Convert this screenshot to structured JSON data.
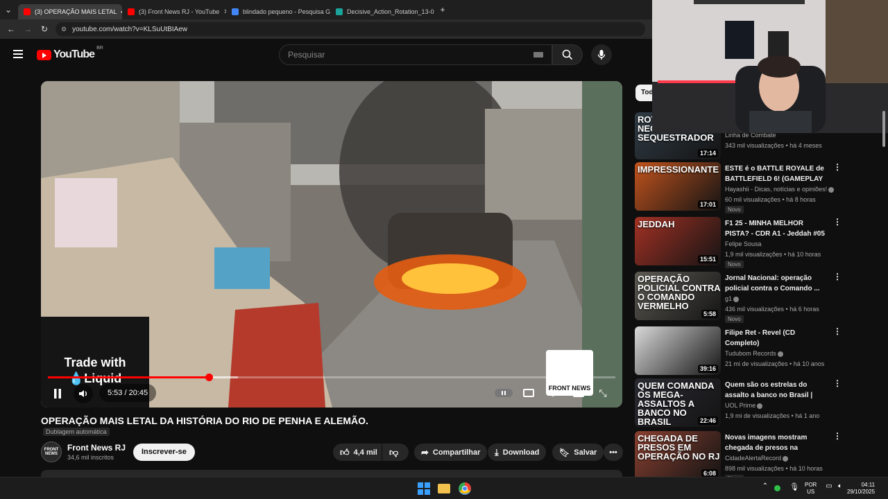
{
  "browser": {
    "tabs": [
      {
        "label": "(3) OPERAÇÃO MAIS LETAL",
        "active": true,
        "fav_color": "#ff0000"
      },
      {
        "label": "(3) Front News RJ - YouTube",
        "active": false,
        "fav_color": "#ff0000"
      },
      {
        "label": "blindado pequeno - Pesquisa G",
        "active": false,
        "fav_color": "#4285f4"
      },
      {
        "label": "Decisive_Action_Rotation_13-0",
        "active": false,
        "fav_color": "#1aa39a"
      }
    ],
    "url": "youtube.com/watch?v=KLSuUtBIAew"
  },
  "header": {
    "logo_text": "YouTube",
    "logo_region": "BR",
    "search_placeholder": "Pesquisar"
  },
  "player": {
    "ad_line1": "Trade with",
    "ad_line2": "Liquid",
    "watermark": "FRONT NEWS",
    "time": "5:53 / 20:45",
    "progress": 0.284,
    "buffered": 0.335
  },
  "video": {
    "title": "OPERAÇÃO MAIS LETAL DA HISTÓRIA DO RIO DE PENHA E ALEMÃO.",
    "dub_label": "Dublagem automática",
    "channel_name": "Front News RJ",
    "subscribers": "34,6 mil inscritos",
    "subscribe_label": "Inscrever-se",
    "likes": "4,4 mil",
    "share_label": "Compartilhar",
    "download_label": "Download",
    "save_label": "Salvar"
  },
  "sidebar": {
    "chip": "Todos",
    "items": [
      {
        "thumb_caption": "ROTA E GATE NEGOCIAM COM SEQUESTRADOR",
        "duration": "17:14",
        "title": "",
        "channel": "Linha de Combate",
        "meta": "343 mil visualizações • há 4 meses",
        "verified": false,
        "badge": "",
        "thumb_color": "#2f3b44"
      },
      {
        "thumb_caption": "IMPRESSIONANTE",
        "duration": "17:01",
        "title": "ESTE é o BATTLE ROYALE de BATTLEFIELD 6! (GAMEPLAY ...",
        "channel": "Hayashii - Dicas, notícias e opiniões!",
        "meta": "60 mil visualizações • há 8 horas",
        "verified": true,
        "badge": "Novo",
        "thumb_color": "#c1531d"
      },
      {
        "thumb_caption": "JEDDAH",
        "duration": "15:51",
        "title": "F1 25 - MINHA MELHOR PISTA? - CDR A1 - Jeddah #05",
        "channel": "Felipe Sousa",
        "meta": "1,9 mil visualizações • há 10 horas",
        "verified": false,
        "badge": "Novo",
        "thumb_color": "#a33124"
      },
      {
        "thumb_caption": "OPERAÇÃO POLICIAL CONTRA O COMANDO VERMELHO",
        "duration": "5:58",
        "title": "Jornal Nacional: operação policial contra o Comando ...",
        "channel": "g1",
        "meta": "436 mil visualizações • há 6 horas",
        "verified": true,
        "badge": "Novo",
        "thumb_color": "#5c5a52"
      },
      {
        "thumb_caption": "",
        "duration": "39:16",
        "title": "Filipe Ret - Revel (CD Completo)",
        "channel": "Tudubom Records",
        "meta": "21 mi de visualizações • há 10 anos",
        "verified": true,
        "badge": "",
        "thumb_color": "#d9d9d9"
      },
      {
        "thumb_caption": "QUEM COMANDA OS MEGA-ASSALTOS A BANCO NO BRASIL",
        "duration": "22:46",
        "title": "Quem são os estrelas do assalto a banco no Brasil | Doc...",
        "channel": "UOL Prime",
        "meta": "1,9 mi de visualizações • há 1 ano",
        "verified": true,
        "badge": "",
        "thumb_color": "#2a2a33"
      },
      {
        "thumb_caption": "CHEGADA DE PRESOS EM OPERAÇÃO NO RJ",
        "duration": "6:08",
        "title": "Novas imagens mostram chegada de presos na delegac...",
        "channel": "CidadeAlertaRecord",
        "meta": "898 mil visualizações • há 10 horas",
        "verified": true,
        "badge": "Novo",
        "thumb_color": "#8a4030"
      }
    ]
  },
  "taskbar": {
    "lang_line1": "POR",
    "lang_line2": "US",
    "clock_time": "04:11",
    "clock_date": "29/10/2025"
  }
}
